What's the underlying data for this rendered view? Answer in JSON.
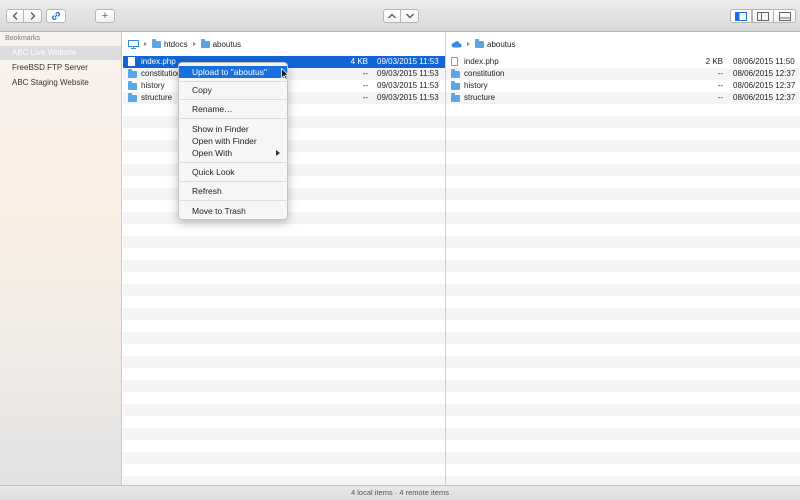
{
  "toolbar": {
    "back_icon": "chevron-left-icon",
    "forward_icon": "chevron-right-icon",
    "link_icon": "link-icon",
    "add_label": "+",
    "up_icon": "chevron-up-icon",
    "down_icon": "chevron-down-icon",
    "view_icons": [
      "sidebar-left-icon",
      "sidebar-panel-icon",
      "bottom-panel-icon"
    ]
  },
  "sidebar": {
    "heading": "Bookmarks",
    "items": [
      {
        "label": "ABC Live Website",
        "selected": true
      },
      {
        "label": "FreeBSD FTP Server",
        "selected": false
      },
      {
        "label": "ABC Staging Website",
        "selected": false
      }
    ]
  },
  "local": {
    "breadcrumb": [
      "htdocs",
      "aboutus"
    ],
    "rows": [
      {
        "name": "index.php",
        "kind": "file",
        "size": "4 KB",
        "date": "09/03/2015 11:53",
        "selected": true
      },
      {
        "name": "constitution",
        "kind": "folder",
        "size": "--",
        "date": "09/03/2015 11:53"
      },
      {
        "name": "history",
        "kind": "folder",
        "size": "--",
        "date": "09/03/2015 11:53"
      },
      {
        "name": "structure",
        "kind": "folder",
        "size": "--",
        "date": "09/03/2015 11:53"
      }
    ]
  },
  "remote": {
    "breadcrumb": [
      "aboutus"
    ],
    "rows": [
      {
        "name": "index.php",
        "kind": "file",
        "size": "2 KB",
        "date": "08/06/2015 11:50"
      },
      {
        "name": "constitution",
        "kind": "folder",
        "size": "--",
        "date": "08/06/2015 12:37"
      },
      {
        "name": "history",
        "kind": "folder",
        "size": "--",
        "date": "08/06/2015 12:37"
      },
      {
        "name": "structure",
        "kind": "folder",
        "size": "--",
        "date": "08/06/2015 12:37"
      }
    ]
  },
  "context_menu": {
    "upload": "Upload to \"aboutus\"",
    "copy": "Copy",
    "rename": "Rename…",
    "show_in_finder": "Show in Finder",
    "open_with_finder": "Open with Finder",
    "open_with": "Open With",
    "quick_look": "Quick Look",
    "refresh": "Refresh",
    "move_to_trash": "Move to Trash"
  },
  "status": {
    "text": "4 local items · 4 remote items"
  },
  "colors": {
    "selection": "#1165d6",
    "folder": "#5aa5e6"
  }
}
